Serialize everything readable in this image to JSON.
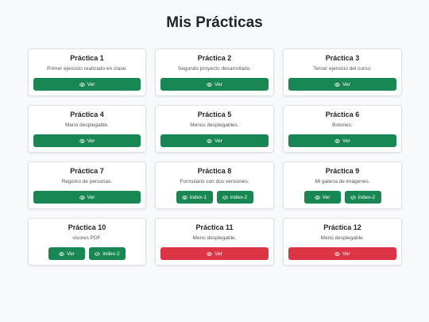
{
  "header": {
    "title": "Mis Prácticas"
  },
  "colors": {
    "success": "#198754",
    "danger": "#dc3545",
    "background": "#f8f9fa"
  },
  "cards": [
    {
      "title": "Práctica 1",
      "desc": "Primer ejercicio realizado en clase.",
      "buttons": [
        {
          "label": "Ver",
          "icon": "eye-icon"
        }
      ]
    },
    {
      "title": "Práctica 2",
      "desc": "Segundo proyecto desarrollado.",
      "buttons": [
        {
          "label": "Ver",
          "icon": "eye-icon"
        }
      ]
    },
    {
      "title": "Práctica 3",
      "desc": "Tercer ejercicio del curso.",
      "buttons": [
        {
          "label": "Ver",
          "icon": "eye-icon"
        }
      ]
    },
    {
      "title": "Práctica 4",
      "desc": "Menú desplegable.",
      "buttons": [
        {
          "label": "Ver",
          "icon": "eye-icon"
        }
      ]
    },
    {
      "title": "Práctica 5",
      "desc": "Menús desplegables.",
      "buttons": [
        {
          "label": "Ver",
          "icon": "eye-icon"
        }
      ]
    },
    {
      "title": "Práctica 6",
      "desc": "Botones.",
      "buttons": [
        {
          "label": "Ver",
          "icon": "eye-icon"
        }
      ]
    },
    {
      "title": "Práctica 7",
      "desc": "Registro de personas.",
      "buttons": [
        {
          "label": "Ver",
          "icon": "eye-icon"
        }
      ]
    },
    {
      "title": "Práctica 8",
      "desc": "Formulario con dos versiones.",
      "buttons": [
        {
          "label": "index-1",
          "icon": "eye-icon"
        },
        {
          "label": "index-2",
          "icon": "code-icon"
        }
      ]
    },
    {
      "title": "Práctica 9",
      "desc": "Mi galería de imágenes.",
      "buttons": [
        {
          "label": "Ver",
          "icon": "eye-icon"
        },
        {
          "label": "index-2",
          "icon": "code-icon"
        }
      ]
    },
    {
      "title": "Práctica 10",
      "desc": "visores PDF.",
      "buttons": [
        {
          "label": "Ver",
          "icon": "eye-icon"
        },
        {
          "label": "index-2",
          "icon": "code-icon"
        }
      ]
    },
    {
      "title": "Práctica 11",
      "desc": "Menú desplegable.",
      "buttons": [
        {
          "label": "Ver",
          "icon": "eye-icon"
        }
      ]
    },
    {
      "title": "Práctica 12",
      "desc": "Menú desplegable.",
      "buttons": [
        {
          "label": "Ver",
          "icon": "eye-icon"
        }
      ]
    }
  ]
}
